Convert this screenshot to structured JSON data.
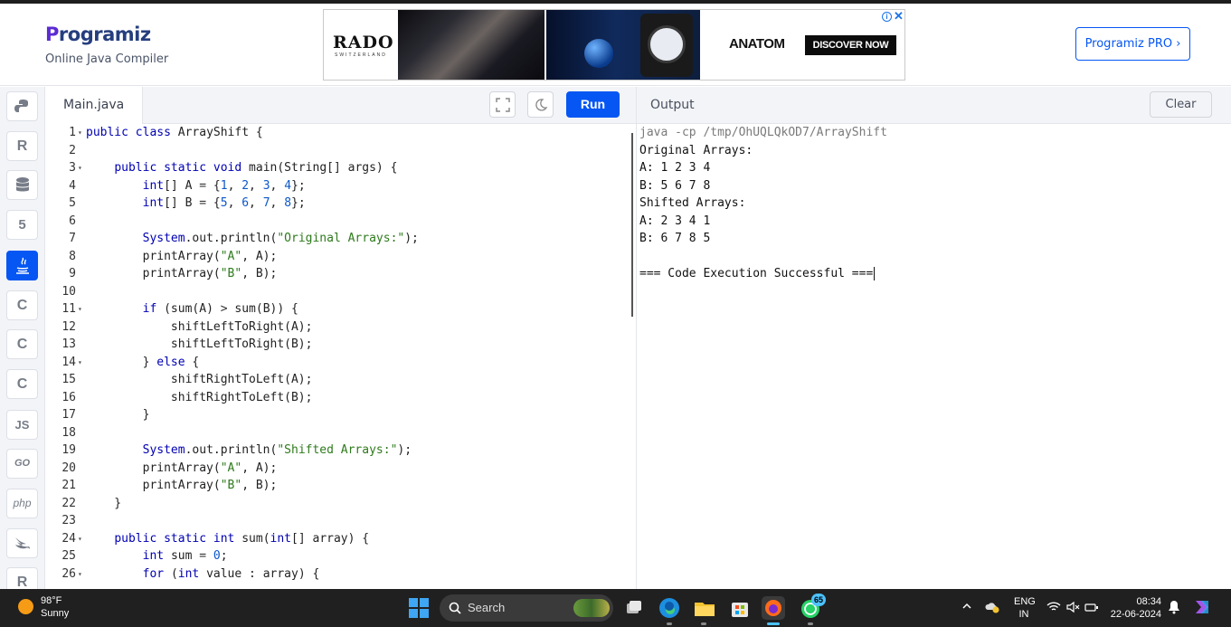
{
  "header": {
    "logo_text": "Programiz",
    "subtitle": "Online Java Compiler",
    "pro_button": "Programiz PRO ›",
    "ad": {
      "brand": "RADO",
      "brand_sub": "SWITZERLAND",
      "product": "ANATOM",
      "cta": "DISCOVER NOW",
      "info_icon": "ⓘ",
      "close_icon": "✕"
    }
  },
  "sidebar": {
    "items": [
      {
        "name": "python-icon",
        "glyph": ""
      },
      {
        "name": "r-icon",
        "glyph": "R"
      },
      {
        "name": "sql-icon",
        "glyph": ""
      },
      {
        "name": "html-icon",
        "glyph": "5"
      },
      {
        "name": "java-icon",
        "glyph": "",
        "active": true
      },
      {
        "name": "c-icon",
        "glyph": "C"
      },
      {
        "name": "cpp-icon",
        "glyph": "C"
      },
      {
        "name": "csharp-icon",
        "glyph": "C"
      },
      {
        "name": "js-icon",
        "glyph": "JS"
      },
      {
        "name": "go-icon",
        "glyph": "GO"
      },
      {
        "name": "php-icon",
        "glyph": "php"
      },
      {
        "name": "swift-icon",
        "glyph": ""
      },
      {
        "name": "rust-icon",
        "glyph": "R"
      }
    ]
  },
  "editor": {
    "file_tab": "Main.java",
    "run_label": "Run",
    "lines": [
      {
        "n": "1",
        "fold": true,
        "tokens": [
          [
            "k",
            "public "
          ],
          [
            "k",
            "class "
          ],
          [
            "",
            "ArrayShift {"
          ]
        ]
      },
      {
        "n": "2",
        "fold": false,
        "tokens": []
      },
      {
        "n": "3",
        "fold": true,
        "tokens": [
          [
            "",
            "    "
          ],
          [
            "k",
            "public "
          ],
          [
            "k",
            "static "
          ],
          [
            "t",
            "void "
          ],
          [
            "",
            "main(String[] args) {"
          ]
        ]
      },
      {
        "n": "4",
        "fold": false,
        "tokens": [
          [
            "",
            "        "
          ],
          [
            "t",
            "int"
          ],
          [
            "",
            "[] A "
          ],
          [
            "sys",
            "= "
          ],
          [
            "",
            "{"
          ],
          [
            "n",
            "1"
          ],
          [
            "",
            ", "
          ],
          [
            "n",
            "2"
          ],
          [
            "",
            ", "
          ],
          [
            "n",
            "3"
          ],
          [
            "",
            ", "
          ],
          [
            "n",
            "4"
          ],
          [
            "",
            "};"
          ]
        ]
      },
      {
        "n": "5",
        "fold": false,
        "tokens": [
          [
            "",
            "        "
          ],
          [
            "t",
            "int"
          ],
          [
            "",
            "[] B "
          ],
          [
            "sys",
            "= "
          ],
          [
            "",
            "{"
          ],
          [
            "n",
            "5"
          ],
          [
            "",
            ", "
          ],
          [
            "n",
            "6"
          ],
          [
            "",
            ", "
          ],
          [
            "n",
            "7"
          ],
          [
            "",
            ", "
          ],
          [
            "n",
            "8"
          ],
          [
            "",
            "};"
          ]
        ]
      },
      {
        "n": "6",
        "fold": false,
        "tokens": []
      },
      {
        "n": "7",
        "fold": false,
        "tokens": [
          [
            "",
            "        "
          ],
          [
            "t",
            "System"
          ],
          [
            "",
            ".out.println("
          ],
          [
            "s",
            "\"Original Arrays:\""
          ],
          [
            "",
            ");"
          ]
        ]
      },
      {
        "n": "8",
        "fold": false,
        "tokens": [
          [
            "",
            "        printArray("
          ],
          [
            "s",
            "\"A\""
          ],
          [
            "",
            ", A);"
          ]
        ]
      },
      {
        "n": "9",
        "fold": false,
        "tokens": [
          [
            "",
            "        printArray("
          ],
          [
            "s",
            "\"B\""
          ],
          [
            "",
            ", B);"
          ]
        ]
      },
      {
        "n": "10",
        "fold": false,
        "tokens": []
      },
      {
        "n": "11",
        "fold": true,
        "tokens": [
          [
            "",
            "        "
          ],
          [
            "k",
            "if "
          ],
          [
            "",
            "(sum(A) "
          ],
          [
            "sys",
            "> "
          ],
          [
            "",
            "sum(B)) {"
          ]
        ]
      },
      {
        "n": "12",
        "fold": false,
        "tokens": [
          [
            "",
            "            shiftLeftToRight(A);"
          ]
        ]
      },
      {
        "n": "13",
        "fold": false,
        "tokens": [
          [
            "",
            "            shiftLeftToRight(B);"
          ]
        ]
      },
      {
        "n": "14",
        "fold": true,
        "tokens": [
          [
            "",
            "        } "
          ],
          [
            "k",
            "else "
          ],
          [
            "",
            "{"
          ]
        ]
      },
      {
        "n": "15",
        "fold": false,
        "tokens": [
          [
            "",
            "            shiftRightToLeft(A);"
          ]
        ]
      },
      {
        "n": "16",
        "fold": false,
        "tokens": [
          [
            "",
            "            shiftRightToLeft(B);"
          ]
        ]
      },
      {
        "n": "17",
        "fold": false,
        "tokens": [
          [
            "",
            "        }"
          ]
        ]
      },
      {
        "n": "18",
        "fold": false,
        "tokens": []
      },
      {
        "n": "19",
        "fold": false,
        "tokens": [
          [
            "",
            "        "
          ],
          [
            "t",
            "System"
          ],
          [
            "",
            ".out.println("
          ],
          [
            "s",
            "\"Shifted Arrays:\""
          ],
          [
            "",
            ");"
          ]
        ]
      },
      {
        "n": "20",
        "fold": false,
        "tokens": [
          [
            "",
            "        printArray("
          ],
          [
            "s",
            "\"A\""
          ],
          [
            "",
            ", A);"
          ]
        ]
      },
      {
        "n": "21",
        "fold": false,
        "tokens": [
          [
            "",
            "        printArray("
          ],
          [
            "s",
            "\"B\""
          ],
          [
            "",
            ", B);"
          ]
        ]
      },
      {
        "n": "22",
        "fold": false,
        "tokens": [
          [
            "",
            "    }"
          ]
        ]
      },
      {
        "n": "23",
        "fold": false,
        "tokens": []
      },
      {
        "n": "24",
        "fold": true,
        "tokens": [
          [
            "",
            "    "
          ],
          [
            "k",
            "public "
          ],
          [
            "k",
            "static "
          ],
          [
            "t",
            "int "
          ],
          [
            "",
            "sum("
          ],
          [
            "t",
            "int"
          ],
          [
            "",
            "[] array) {"
          ]
        ]
      },
      {
        "n": "25",
        "fold": false,
        "tokens": [
          [
            "",
            "        "
          ],
          [
            "t",
            "int "
          ],
          [
            "",
            "sum "
          ],
          [
            "sys",
            "= "
          ],
          [
            "n",
            "0"
          ],
          [
            "",
            ";"
          ]
        ]
      },
      {
        "n": "26",
        "fold": true,
        "tokens": [
          [
            "",
            "        "
          ],
          [
            "k",
            "for "
          ],
          [
            "",
            "("
          ],
          [
            "t",
            "int "
          ],
          [
            "",
            "value : array) {"
          ]
        ]
      }
    ]
  },
  "output": {
    "title": "Output",
    "clear_label": "Clear",
    "lines": [
      "java -cp /tmp/OhUQLQkOD7/ArrayShift",
      "Original Arrays:",
      "A: 1 2 3 4",
      "B: 5 6 7 8",
      "Shifted Arrays:",
      "A: 2 3 4 1",
      "B: 6 7 8 5",
      "",
      "=== Code Execution Successful ==="
    ]
  },
  "taskbar": {
    "weather_temp": "98°F",
    "weather_cond": "Sunny",
    "search_label": "Search",
    "whatsapp_badge": "65",
    "lang_top": "ENG",
    "lang_bottom": "IN",
    "time": "08:34",
    "date": "22-06-2024"
  }
}
